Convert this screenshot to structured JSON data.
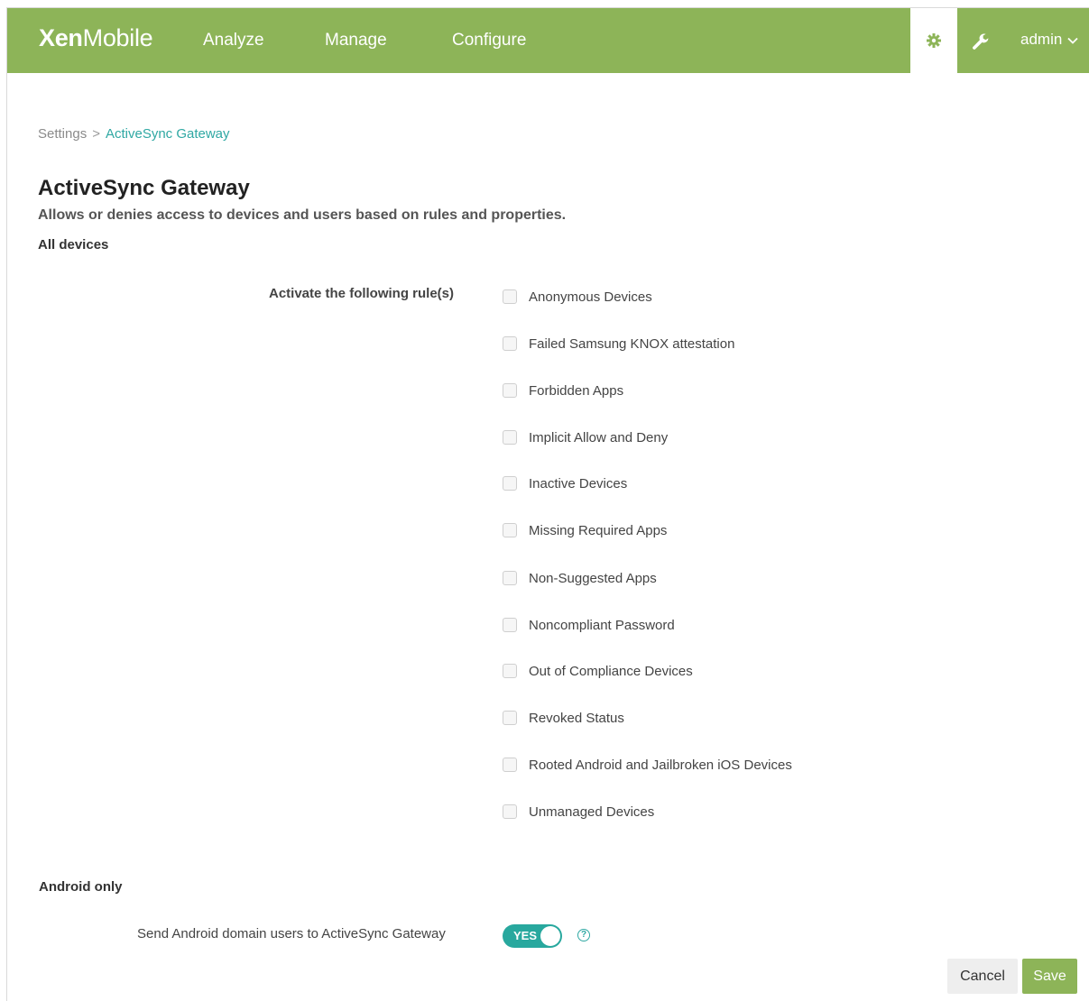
{
  "nav": {
    "logo_bold": "Xen",
    "logo_light": "Mobile",
    "items": [
      "Analyze",
      "Manage",
      "Configure"
    ],
    "icons": [
      "gear-icon",
      "wrench-icon"
    ],
    "user": "admin",
    "accent_color": "#8db458"
  },
  "breadcrumb": {
    "parent": "Settings",
    "separator": ">",
    "current": "ActiveSync Gateway"
  },
  "page": {
    "title": "ActiveSync Gateway",
    "subtitle": "Allows or denies access to devices and users based on rules and properties.",
    "section_all": "All devices",
    "rules_label": "Activate the following rule(s)",
    "rules": [
      "Anonymous Devices",
      "Failed Samsung KNOX attestation",
      "Forbidden Apps",
      "Implicit Allow and Deny",
      "Inactive Devices",
      "Missing Required Apps",
      "Non-Suggested Apps",
      "Noncompliant Password",
      "Out of Compliance Devices",
      "Revoked Status",
      "Rooted Android and Jailbroken iOS Devices",
      "Unmanaged Devices"
    ],
    "rules_checked": [
      false,
      false,
      false,
      false,
      false,
      false,
      false,
      false,
      false,
      false,
      false,
      false
    ],
    "section_android": "Android only",
    "android_toggle_label": "Send Android domain users to ActiveSync Gateway",
    "android_toggle_value": "YES",
    "help_icon": "?"
  },
  "buttons": {
    "cancel": "Cancel",
    "save": "Save"
  }
}
